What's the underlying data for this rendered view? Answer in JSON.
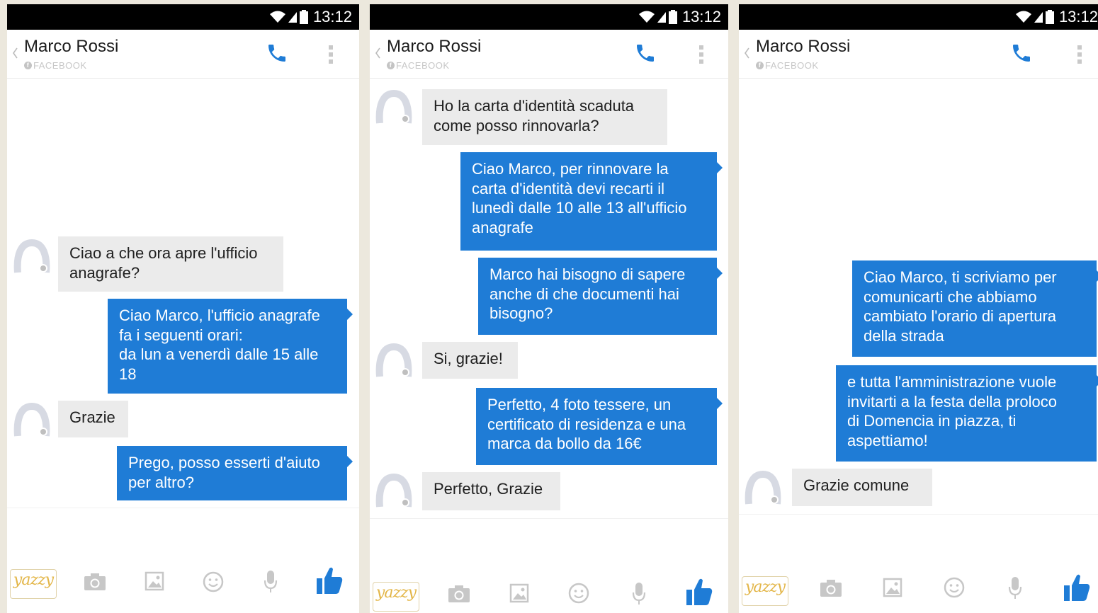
{
  "status_bar": {
    "time": "13:12"
  },
  "conversation": {
    "contact_name": "Marco Rossi",
    "source": "FACEBOOK"
  },
  "composer": {
    "sticker_label": "yazzy",
    "accent": "#1f7cd6"
  },
  "colors": {
    "outgoing_bubble": "#1f7cd6",
    "incoming_bubble": "#ebebeb",
    "like_icon": "#1f7cd6"
  },
  "icons": [
    "wifi-icon",
    "signal-icon",
    "battery-icon",
    "back-icon",
    "phone-call-icon",
    "more-options-icon",
    "avatar-icon",
    "camera-icon",
    "gallery-icon",
    "emoji-icon",
    "microphone-icon",
    "thumbs-up-icon"
  ],
  "screens": [
    {
      "messages": [
        {
          "from": "contact",
          "text": "Ciao a che ora apre l'ufficio\nanagrafe?"
        },
        {
          "from": "page",
          "text": "Ciao Marco, l'ufficio anagrafe\nfa i seguenti orari:\nda lun a venerdì dalle 15 alle\n18"
        },
        {
          "from": "contact",
          "text": "Grazie"
        },
        {
          "from": "page",
          "text": "Prego, posso esserti d'aiuto\nper altro?"
        }
      ]
    },
    {
      "messages": [
        {
          "from": "contact",
          "text": "Ho la carta d'identità scaduta\ncome posso rinnovarla?"
        },
        {
          "from": "page",
          "text": "Ciao Marco, per rinnovare la\ncarta d'identità devi recarti il\nlunedì dalle 10 alle 13 all'ufficio\nanagrafe"
        },
        {
          "from": "page",
          "text": "Marco hai bisogno di sapere\nanche di che documenti hai\nbisogno?"
        },
        {
          "from": "contact",
          "text": "Si, grazie!"
        },
        {
          "from": "page",
          "text": "Perfetto, 4 foto tessere, un\ncertificato di residenza e una\nmarca da bollo da 16€"
        },
        {
          "from": "contact",
          "text": "Perfetto, Grazie"
        }
      ]
    },
    {
      "messages": [
        {
          "from": "page",
          "text": "Ciao Marco, ti scriviamo per\ncomunicarti che abbiamo\ncambiato l'orario di apertura\ndella strada"
        },
        {
          "from": "page",
          "text": "e tutta l'amministrazione vuole\ninvitarti a la festa della proloco\ndi Domencia in piazza, ti\naspettiamo!"
        },
        {
          "from": "contact",
          "text": "Grazie comune"
        }
      ]
    }
  ]
}
